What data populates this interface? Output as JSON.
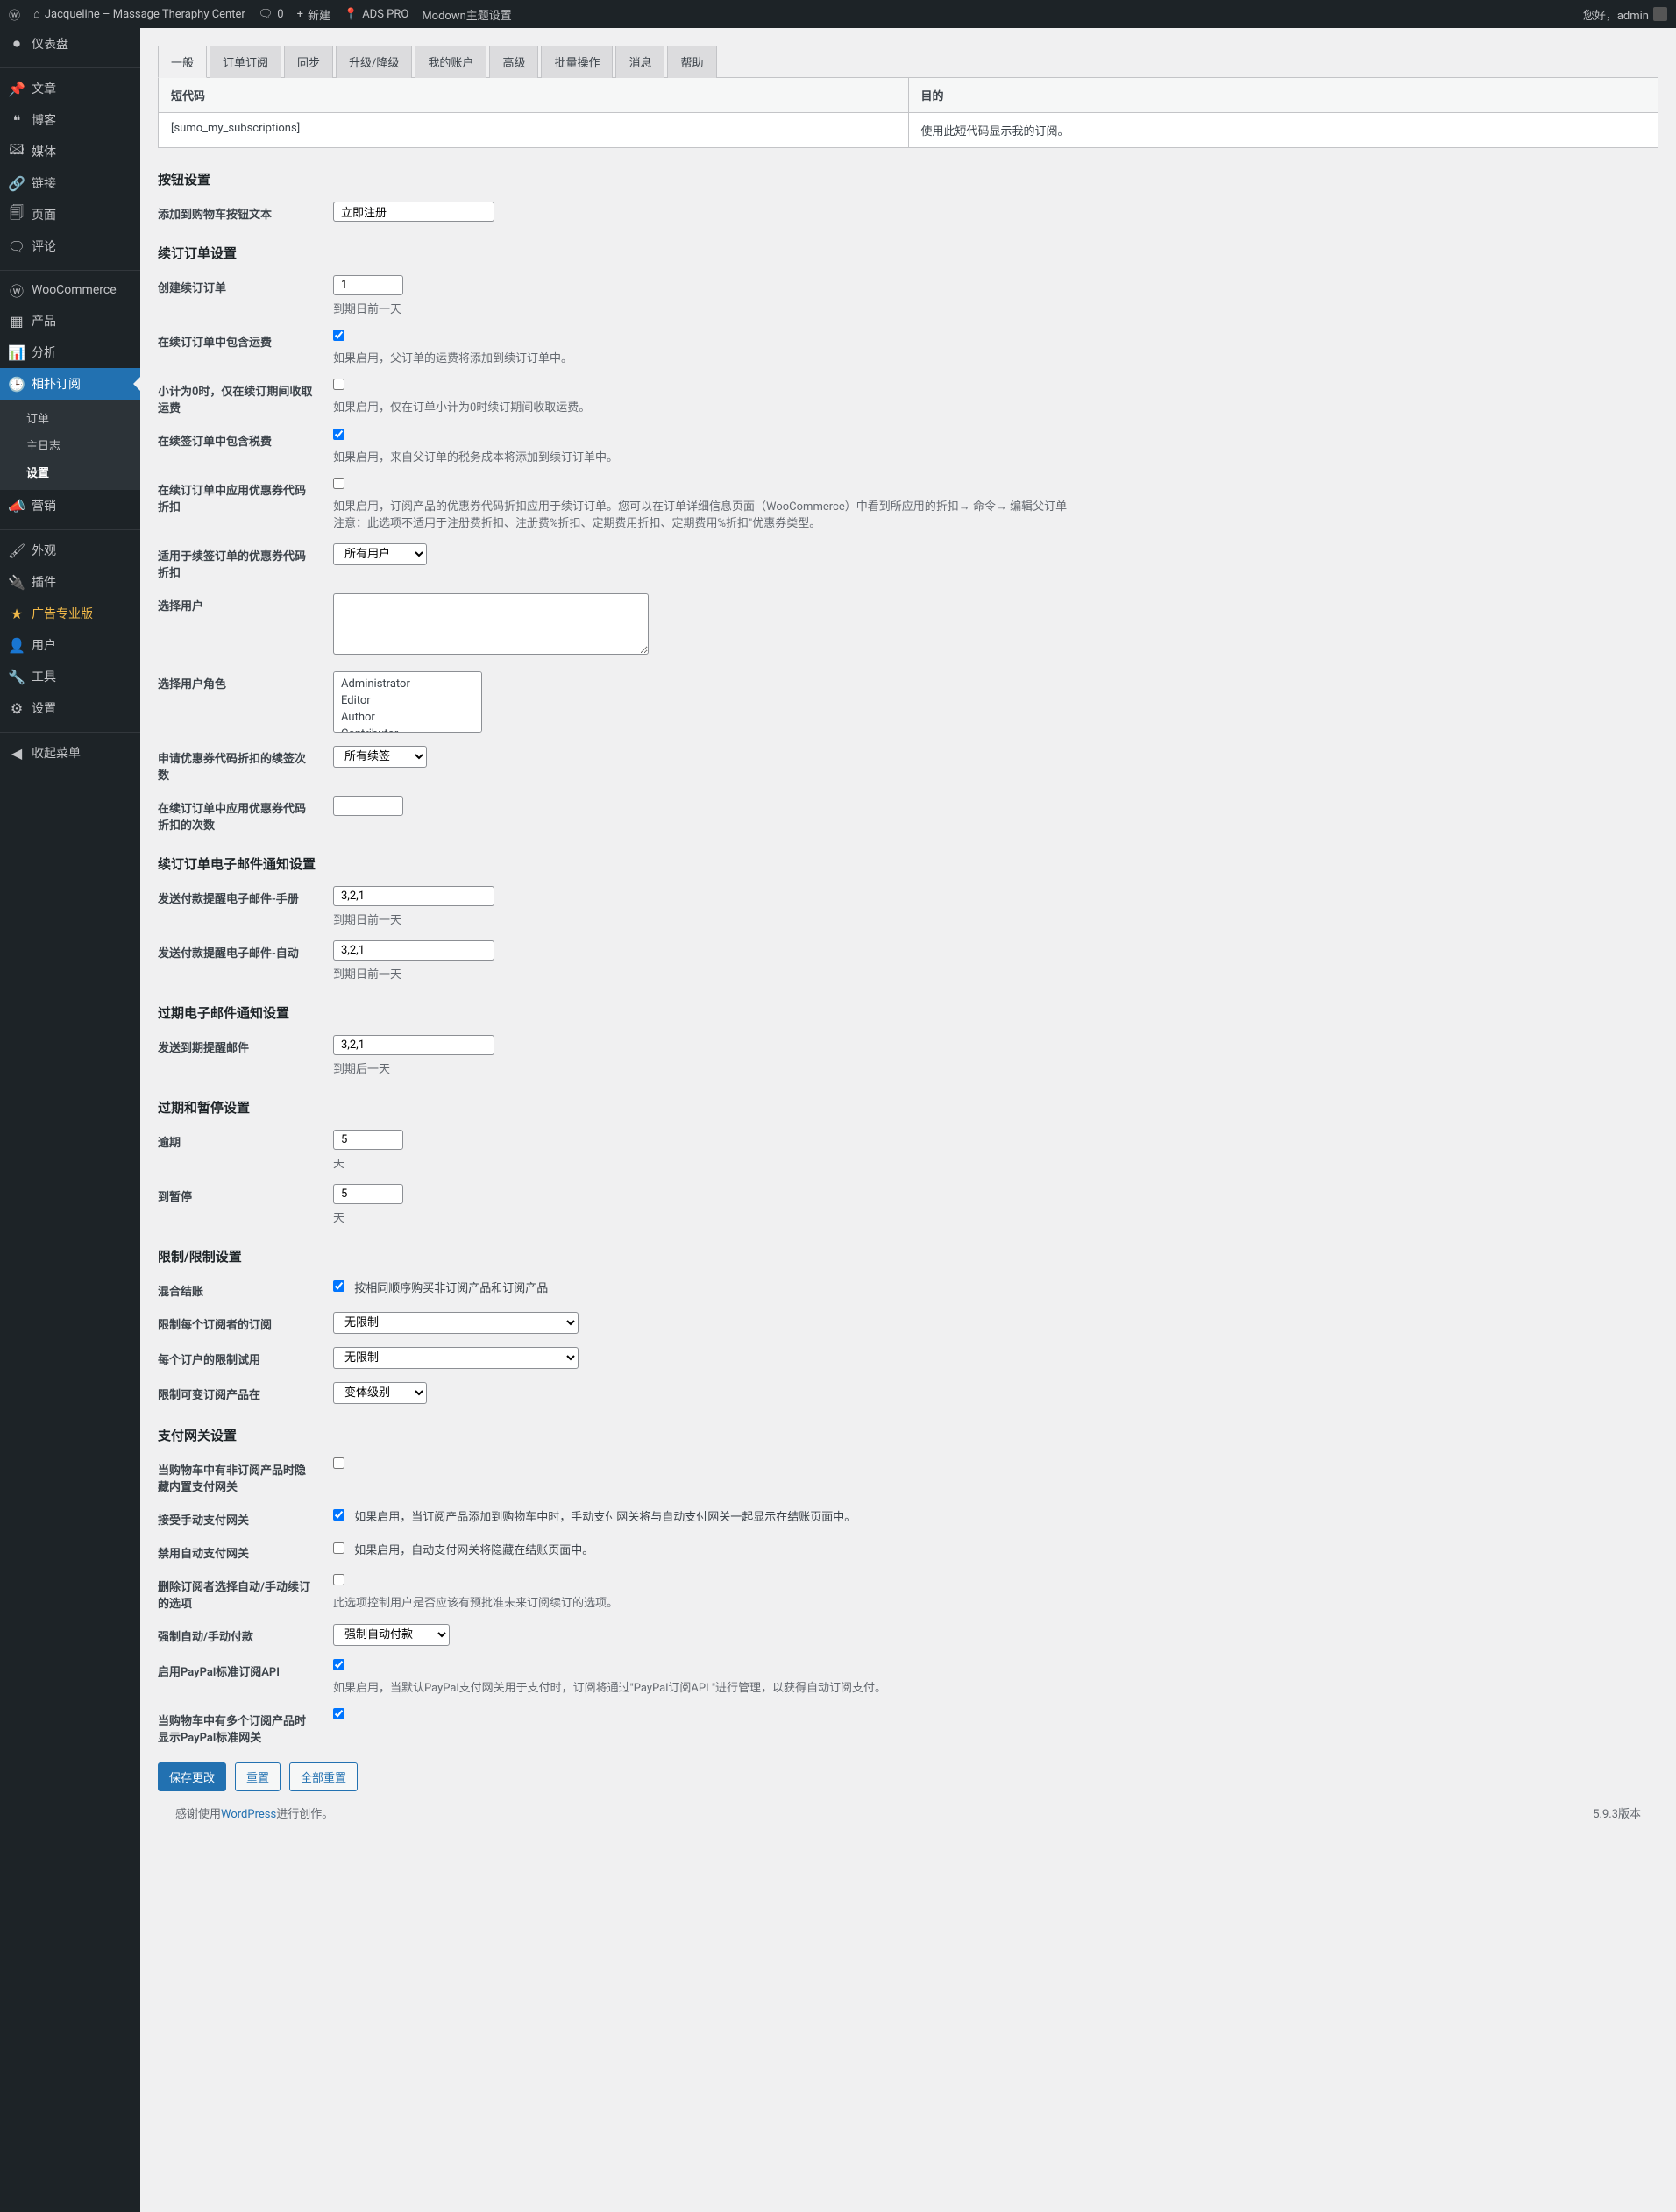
{
  "adminbar": {
    "site_name": "Jacqueline – Massage Theraphy Center",
    "comments": "0",
    "new": "新建",
    "ads_pro": "ADS PRO",
    "modown": "Modown主题设置",
    "greeting": "您好，admin",
    "plus": "+"
  },
  "sidebar": {
    "dashboard": "仪表盘",
    "posts": "文章",
    "blog": "博客",
    "media": "媒体",
    "links": "链接",
    "pages": "页面",
    "comments": "评论",
    "woocommerce": "WooCommerce",
    "products": "产品",
    "analytics": "分析",
    "subscriptions": "相扑订阅",
    "sub_orders": "订单",
    "sub_master": "主日志",
    "sub_settings": "设置",
    "marketing": "营销",
    "appearance": "外观",
    "plugins": "插件",
    "ads_pro": "广告专业版",
    "users": "用户",
    "tools": "工具",
    "settings": "设置",
    "collapse": "收起菜单"
  },
  "tabs": {
    "general": "一般",
    "order_sub": "订单订阅",
    "sync": "同步",
    "upgrade": "升级/降级",
    "my_account": "我的账户",
    "advanced": "高级",
    "bulk": "批量操作",
    "messages": "消息",
    "help": "帮助"
  },
  "table": {
    "shortcode_header": "短代码",
    "purpose_header": "目的",
    "shortcode_value": "[sumo_my_subscriptions]",
    "purpose_value": "使用此短代码显示我的订阅。"
  },
  "sections": {
    "button": "按钮设置",
    "button_label": "添加到购物车按钮文本",
    "button_value": "立即注册",
    "renewal": "续订订单设置",
    "create_renewal_label": "创建续订订单",
    "create_renewal_value": "1",
    "create_renewal_help": "到期日前一天",
    "shipping_label": "在续订订单中包含运费",
    "shipping_help": "如果启用，父订单的运费将添加到续订订单中。",
    "subtotal_label": "小计为0时，仅在续订期间收取运费",
    "subtotal_help": "如果启用，仅在订单小计为0时续订期间收取运费。",
    "tax_label": "在续签订单中包含税费",
    "tax_help": "如果启用，来自父订单的税务成本将添加到续订订单中。",
    "coupon_label": "在续订订单中应用优惠券代码折扣",
    "coupon_help": "如果启用，订阅产品的优惠券代码折扣应用于续订订单。您可以在订单详细信息页面（WooCommerce）中看到所应用的折扣→ 命令→ 编辑父订单\n注意：此选项不适用于注册费折扣、注册费%折扣、定期费用折扣、定期费用%折扣\"优惠券类型。",
    "discount_user_label": "适用于续签订单的优惠券代码折扣",
    "discount_user_value": "所有用户",
    "select_user_label": "选择用户",
    "select_role_label": "选择用户角色",
    "roles": [
      "Administrator",
      "Editor",
      "Author",
      "Contributor"
    ],
    "renewal_count_label": "申请优惠券代码折扣的续签次数",
    "renewal_count_value": "所有续签",
    "discount_times_label": "在续订订单中应用优惠券代码折扣的次数",
    "email_section": "续订订单电子邮件通知设置",
    "email_manual_label": "发送付款提醒电子邮件-手册",
    "email_manual_value": "3,2,1",
    "email_manual_help": "到期日前一天",
    "email_auto_label": "发送付款提醒电子邮件-自动",
    "email_auto_value": "3,2,1",
    "email_auto_help": "到期日前一天",
    "overdue_section": "过期电子邮件通知设置",
    "overdue_email_label": "发送到期提醒邮件",
    "overdue_email_value": "3,2,1",
    "overdue_email_help": "到期后一天",
    "expiry_section": "过期和暂停设置",
    "overdue_label": "逾期",
    "overdue_value": "5",
    "overdue_help": "天",
    "expiry_label": "到暂停",
    "expiry_value": "5",
    "expiry_help": "天",
    "limit_section": "限制/限制设置",
    "mixed_label": "混合结账",
    "mixed_text": "按相同顺序购买非订阅产品和订阅产品",
    "limit_sub_label": "限制每个订阅者的订阅",
    "limit_sub_value": "无限制",
    "limit_trial_label": "每个订户的限制试用",
    "limit_trial_value": "无限制",
    "limit_variant_label": "限制可变订阅产品在",
    "limit_variant_value": "变体级别",
    "gateway_section": "支付网关设置",
    "hide_gateway_label": "当购物车中有非订阅产品时隐藏内置支付网关",
    "manual_gateway_label": "接受手动支付网关",
    "manual_gateway_text": "如果启用，当订阅产品添加到购物车中时，手动支付网关将与自动支付网关一起显示在结账页面中。",
    "disable_auto_label": "禁用自动支付网关",
    "disable_auto_text": "如果启用，自动支付网关将隐藏在结账页面中。",
    "delete_sub_label": "删除订阅者选择自动/手动续订的选项",
    "delete_sub_text": "此选项控制用户是否应该有预批准未来订阅续订的选项。",
    "force_pay_label": "强制自动/手动付款",
    "force_pay_value": "强制自动付款",
    "paypal_label": "启用PayPal标准订阅API",
    "paypal_help": "如果启用，当默认PayPal支付网关用于支付时，订阅将通过\"PayPal订阅API \"进行管理，以获得自动订阅支付。",
    "multi_paypal_label": "当购物车中有多个订阅产品时显示PayPal标准网关",
    "save": "保存更改",
    "reset": "重置",
    "reset_all": "全部重置"
  },
  "footer": {
    "thanks_prefix": "感谢使用",
    "wordpress": "WordPress",
    "thanks_suffix": "进行创作。",
    "version": "5.9.3版本"
  }
}
